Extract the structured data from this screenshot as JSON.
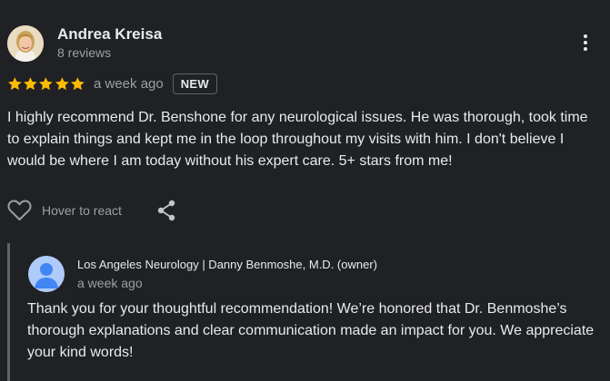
{
  "reviewer": {
    "name": "Andrea Kreisa",
    "meta": "8 reviews",
    "avatar_icon": "person-photo-avatar"
  },
  "review": {
    "star_count": 5,
    "rating_max": 5,
    "star_color": "#fbbc04",
    "date": "a week ago",
    "badge": "NEW",
    "text": "I highly recommend Dr. Benshone for any neurological issues. He was thorough, took time to explain things and kept me in the loop throughout my visits with him. I don't believe I would be where I am today without his expert care. 5+ stars from me!"
  },
  "actions": {
    "react_label": "Hover to react",
    "like_icon": "heart-outline-icon",
    "share_icon": "share-icon",
    "more_icon": "more-vertical-icon"
  },
  "owner_reply": {
    "name": "Los Angeles Neurology | Danny Benmoshe, M.D. (owner)",
    "date": "a week ago",
    "text": "Thank you for your thoughtful recommendation! We’re honored that Dr. Benmoshe’s thorough explanations and clear communication made an impact for you. We appreciate your kind words!",
    "avatar_icon": "default-person-avatar",
    "avatar_color": "#aecbfa",
    "avatar_figure_color": "#4285f4"
  }
}
